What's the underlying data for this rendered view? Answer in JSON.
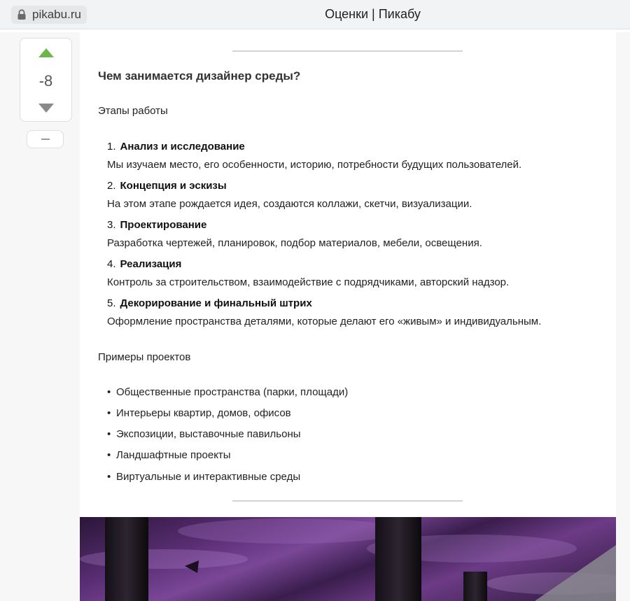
{
  "browser": {
    "domain": "pikabu.ru",
    "title": "Оценки | Пикабу"
  },
  "rating": {
    "value": "-8",
    "collapse": "—"
  },
  "article": {
    "heading": "Чем занимается дизайнер среды?",
    "stages_title": "Этапы работы",
    "stages": [
      {
        "num": "1.",
        "title": "Анализ и исследование",
        "desc": "Мы изучаем место, его особенности, историю, потребности будущих пользователей."
      },
      {
        "num": "2.",
        "title": "Концепция и эскизы",
        "desc": "На этом этапе рождается идея, создаются коллажи, скетчи, визуализации."
      },
      {
        "num": "3.",
        "title": "Проектирование",
        "desc": "Разработка чертежей, планировок, подбор материалов, мебели, освещения."
      },
      {
        "num": "4.",
        "title": "Реализация",
        "desc": "Контроль за строительством, взаимодействие с подрядчиками, авторский надзор."
      },
      {
        "num": "5.",
        "title": "Декорирование и финальный штрих",
        "desc": "Оформление пространства деталями, которые делают его «живым» и индивидуальным."
      }
    ],
    "examples_title": "Примеры проектов",
    "examples": [
      "Общественные пространства (парки, площади)",
      "Интерьеры квартир, домов, офисов",
      "Экспозиции, выставочные павильоны",
      "Ландшафтные проекты",
      "Виртуальные и интерактивные среды"
    ]
  },
  "colors": {
    "upvote": "#6eb64a",
    "downvote": "#8a8a8a"
  }
}
